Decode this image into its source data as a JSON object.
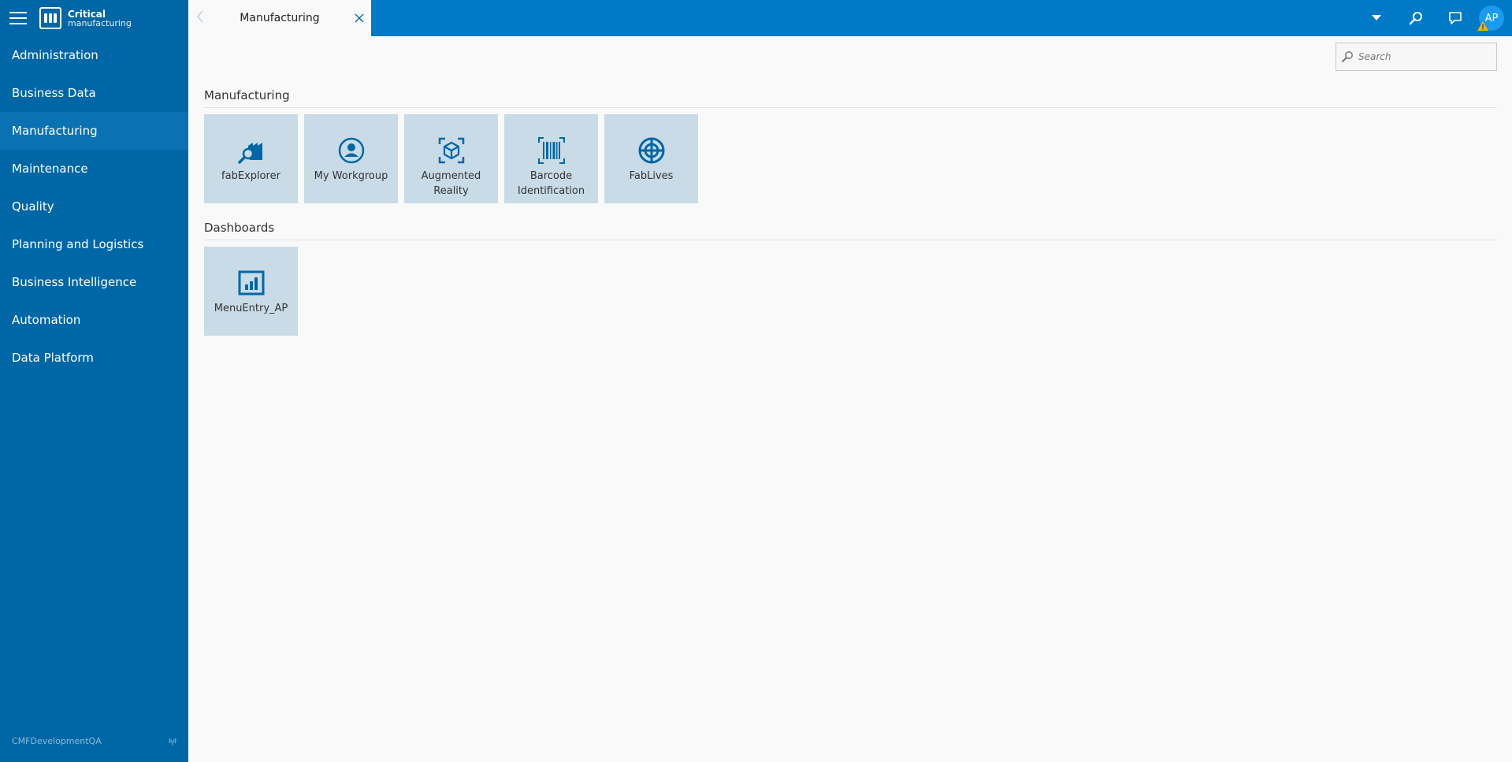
{
  "brand": {
    "line1": "Critical",
    "line2": "manufacturing"
  },
  "sidebar": {
    "items": [
      {
        "label": "Administration"
      },
      {
        "label": "Business Data"
      },
      {
        "label": "Manufacturing",
        "active": true
      },
      {
        "label": "Maintenance"
      },
      {
        "label": "Quality"
      },
      {
        "label": "Planning and Logistics"
      },
      {
        "label": "Business Intelligence"
      },
      {
        "label": "Automation"
      },
      {
        "label": "Data Platform"
      }
    ],
    "footer": {
      "environment": "CMFDevelopmentQA"
    }
  },
  "tab": {
    "title": "Manufacturing"
  },
  "user": {
    "initials": "AP"
  },
  "search": {
    "placeholder": "Search"
  },
  "sections": [
    {
      "title": "Manufacturing",
      "tiles": [
        {
          "label": "fabExplorer",
          "icon": "fab-explorer-icon"
        },
        {
          "label": "My Workgroup",
          "icon": "user-circle-icon"
        },
        {
          "label": "Augmented Reality",
          "icon": "ar-cube-icon"
        },
        {
          "label": "Barcode Identification",
          "icon": "barcode-icon"
        },
        {
          "label": "FabLives",
          "icon": "target-icon"
        }
      ]
    },
    {
      "title": "Dashboards",
      "tiles": [
        {
          "label": "MenuEntry_AP",
          "icon": "dashboard-chart-icon"
        }
      ]
    }
  ],
  "colors": {
    "sidebar": "#0067a6",
    "topbar": "#0079c6",
    "tile": "#c9dbe7",
    "icon": "#0067a6"
  }
}
